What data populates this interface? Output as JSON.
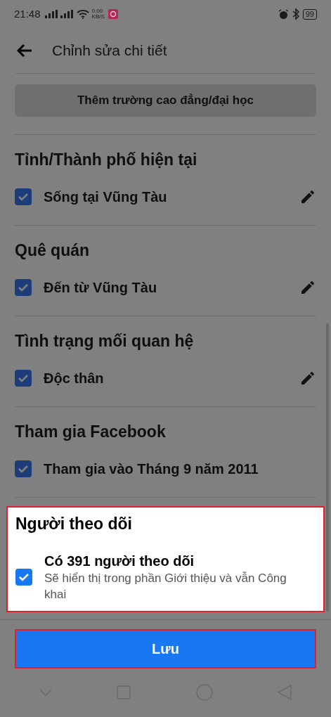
{
  "status_bar": {
    "time": "21:48",
    "speed_value": "0.00",
    "speed_unit": "KB/S",
    "battery": "99"
  },
  "header": {
    "title": "Chỉnh sửa chi tiết"
  },
  "add_school_button": {
    "label": "Thêm trường cao đẳng/đại học",
    "highlighted": false
  },
  "sections": [
    {
      "title": "Tỉnh/Thành phố hiện tại",
      "highlighted": false,
      "items": [
        {
          "label": "Sống tại Vũng Tàu",
          "checked": true,
          "editable": true
        }
      ]
    },
    {
      "title": "Quê quán",
      "highlighted": false,
      "items": [
        {
          "label": "Đến từ Vũng Tàu",
          "checked": true,
          "editable": true
        }
      ]
    },
    {
      "title": "Tình trạng mối quan hệ",
      "highlighted": false,
      "items": [
        {
          "label": "Độc thân",
          "checked": true,
          "editable": true
        }
      ]
    },
    {
      "title": "Tham gia Facebook",
      "highlighted": false,
      "items": [
        {
          "label": "Tham gia vào Tháng 9 năm 2011",
          "checked": true,
          "editable": false
        }
      ]
    },
    {
      "title": "Người theo dõi",
      "highlighted": true,
      "items": [
        {
          "label": "Có 391 người theo dõi",
          "description": "Sẽ hiển thị trong phần Giới thiệu và vẫn Công khai",
          "checked": true,
          "editable": false
        }
      ]
    }
  ],
  "save_button": {
    "label": "Lưu",
    "highlighted": true
  }
}
